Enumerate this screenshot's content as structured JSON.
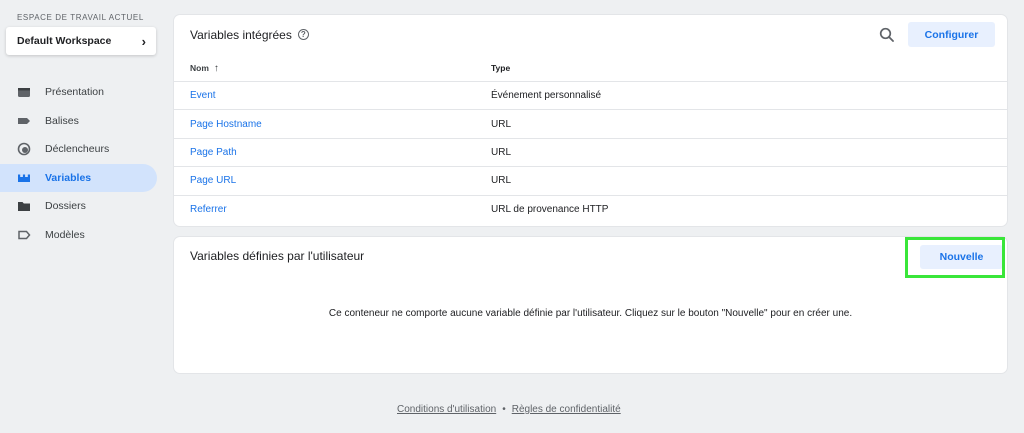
{
  "sidebar": {
    "workspace_label": "ESPACE DE TRAVAIL ACTUEL",
    "workspace_name": "Default Workspace",
    "items": [
      {
        "label": "Présentation",
        "icon": "overview-icon"
      },
      {
        "label": "Balises",
        "icon": "tag-icon"
      },
      {
        "label": "Déclencheurs",
        "icon": "trigger-icon"
      },
      {
        "label": "Variables",
        "icon": "variables-icon",
        "active": true
      },
      {
        "label": "Dossiers",
        "icon": "folder-icon"
      },
      {
        "label": "Modèles",
        "icon": "template-icon"
      }
    ]
  },
  "builtin": {
    "title": "Variables intégrées",
    "configure_label": "Configurer",
    "columns": {
      "name": "Nom",
      "type": "Type"
    },
    "rows": [
      {
        "name": "Event",
        "type": "Événement personnalisé"
      },
      {
        "name": "Page Hostname",
        "type": "URL"
      },
      {
        "name": "Page Path",
        "type": "URL"
      },
      {
        "name": "Page URL",
        "type": "URL"
      },
      {
        "name": "Referrer",
        "type": "URL de provenance HTTP"
      }
    ]
  },
  "user_defined": {
    "title": "Variables définies par l'utilisateur",
    "new_label": "Nouvelle",
    "empty_message": "Ce conteneur ne comporte aucune variable définie par l'utilisateur. Cliquez sur le bouton \"Nouvelle\" pour en créer une."
  },
  "footer": {
    "terms": "Conditions d'utilisation",
    "separator": "•",
    "privacy": "Règles de confidentialité"
  },
  "colors": {
    "accent": "#1a73e8",
    "active_bg": "#d2e3fc",
    "button_bg": "#e8f0fe",
    "highlight": "#39e639"
  }
}
